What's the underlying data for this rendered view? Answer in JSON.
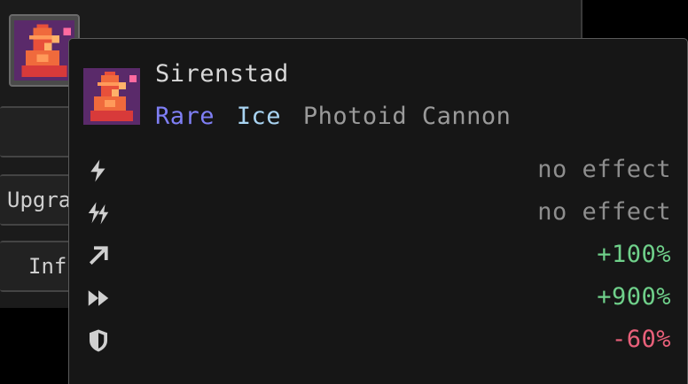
{
  "background": {
    "buttons": {
      "upgrade_label": "Upgra",
      "info_label": "Inf"
    }
  },
  "item": {
    "name": "Sirenstad",
    "rarity": "Rare",
    "element": "Ice",
    "weapon_type": "Photoid Cannon",
    "icon": "cannon-sprite-icon",
    "colors": {
      "rarity": "#7f7ff5",
      "element": "#a9d4f2",
      "positive": "#6fd08a",
      "negative": "#e8607a",
      "neutral": "#8e8e8e"
    }
  },
  "stats": [
    {
      "icon": "lightning-icon",
      "value": "no effect",
      "tone": "neutral"
    },
    {
      "icon": "double-lightning-icon",
      "value": "no effect",
      "tone": "neutral"
    },
    {
      "icon": "arrow-up-right-icon",
      "value": "+100%",
      "tone": "positive"
    },
    {
      "icon": "fast-forward-icon",
      "value": "+900%",
      "tone": "positive"
    },
    {
      "icon": "shield-icon",
      "value": "-60%",
      "tone": "negative"
    }
  ]
}
